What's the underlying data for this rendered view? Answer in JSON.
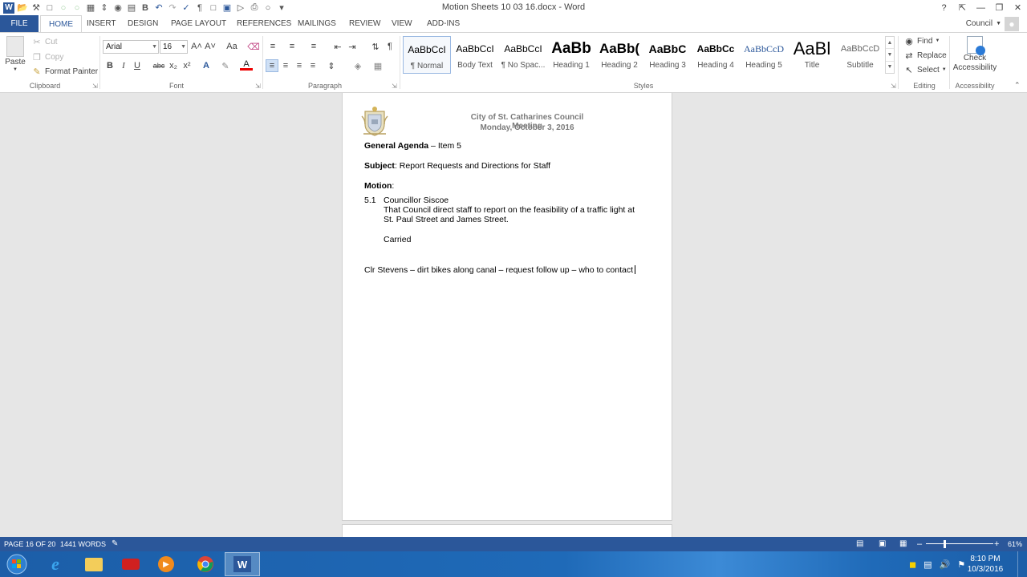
{
  "window": {
    "title": "Motion Sheets 10 03 16.docx - Word",
    "help": "?",
    "user_name": "Council"
  },
  "tabs": [
    {
      "label": "FILE"
    },
    {
      "label": "HOME"
    },
    {
      "label": "INSERT"
    },
    {
      "label": "DESIGN"
    },
    {
      "label": "PAGE LAYOUT"
    },
    {
      "label": "REFERENCES"
    },
    {
      "label": "MAILINGS"
    },
    {
      "label": "REVIEW"
    },
    {
      "label": "VIEW"
    },
    {
      "label": "ADD-INS"
    }
  ],
  "ribbon": {
    "clipboard": {
      "paste": "Paste",
      "cut": "Cut",
      "copy": "Copy",
      "format_painter": "Format Painter",
      "label": "Clipboard"
    },
    "font": {
      "font_name": "Arial",
      "font_size": "16",
      "label": "Font",
      "bold": "B",
      "italic": "I",
      "underline": "U",
      "strike": "abc",
      "subscript": "x₂",
      "superscript": "x²",
      "grow": "A˄",
      "shrink": "A˅",
      "change_case": "Aa",
      "effects": "A",
      "font_color": "A"
    },
    "paragraph": {
      "label": "Paragraph",
      "pilcrow": "¶"
    },
    "styles": {
      "label": "Styles",
      "items": [
        {
          "preview": "AaBbCcI",
          "name": "¶ Normal"
        },
        {
          "preview": "AaBbCcI",
          "name": "Body Text"
        },
        {
          "preview": "AaBbCcI",
          "name": "¶ No Spac..."
        },
        {
          "preview": "AaBb",
          "name": "Heading 1"
        },
        {
          "preview": "AaBb(",
          "name": "Heading 2"
        },
        {
          "preview": "AaBbC",
          "name": "Heading 3"
        },
        {
          "preview": "AaBbCc",
          "name": "Heading 4"
        },
        {
          "preview": "AaBbCcD",
          "name": "Heading 5"
        },
        {
          "preview": "AaBl",
          "name": "Title"
        },
        {
          "preview": "AaBbCcD",
          "name": "Subtitle"
        }
      ]
    },
    "editing": {
      "find": "Find",
      "replace": "Replace",
      "select": "Select",
      "label": "Editing"
    },
    "accessibility": {
      "check": "Check",
      "accessibility": "Accessibility",
      "label": "Accessibility"
    }
  },
  "document": {
    "header_line1": "City of St. Catharines Council Meeting",
    "header_line2": "Monday, October 3, 2016",
    "agenda_bold": "General Agenda",
    "agenda_rest": " – Item 5",
    "subject_bold": "Subject",
    "subject_rest": ": Report Requests and Directions for Staff",
    "motion_bold": "Motion",
    "motion_rest": ":",
    "item_number": "5.1",
    "item_mover": "Councillor Siscoe",
    "item_text1": "That Council direct staff to report on the feasibility of a traffic light at",
    "item_text2": "St. Paul Street and James Street.",
    "item_result": "Carried",
    "note": "Clr Stevens – dirt bikes along canal – request follow up – who to contact"
  },
  "statusbar": {
    "page": "PAGE 16 OF 20",
    "words": "1441 WORDS",
    "zoom": "61%",
    "zoom_minus": "–",
    "zoom_plus": "+"
  },
  "taskbar": {
    "time": "8:10 PM",
    "date": "10/3/2016"
  },
  "colors": {
    "accent": "#2b579a",
    "taskbar": "#1f6ab8"
  }
}
